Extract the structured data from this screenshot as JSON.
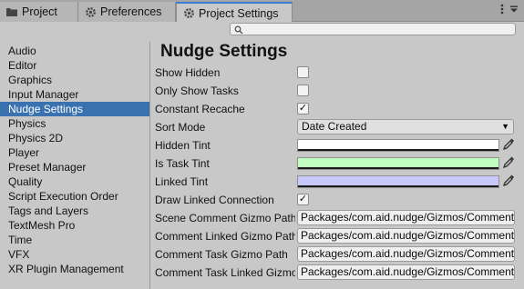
{
  "tabs": [
    {
      "label": "Project",
      "icon": "folder-icon"
    },
    {
      "label": "Preferences",
      "icon": "gear-icon"
    },
    {
      "label": "Project Settings",
      "icon": "gear-icon"
    }
  ],
  "search": {
    "placeholder": ""
  },
  "sidebar": {
    "items": [
      "Audio",
      "Editor",
      "Graphics",
      "Input Manager",
      "Nudge Settings",
      "Physics",
      "Physics 2D",
      "Player",
      "Preset Manager",
      "Quality",
      "Script Execution Order",
      "Tags and Layers",
      "TextMesh Pro",
      "Time",
      "VFX",
      "XR Plugin Management"
    ],
    "selected": "Nudge Settings"
  },
  "main": {
    "title": "Nudge Settings",
    "show_hidden": {
      "label": "Show Hidden",
      "checked": false
    },
    "only_show_tasks": {
      "label": "Only Show Tasks",
      "checked": false
    },
    "constant_recache": {
      "label": "Constant Recache",
      "checked": true,
      "mark": "✓"
    },
    "sort_mode": {
      "label": "Sort Mode",
      "value": "Date Created"
    },
    "hidden_tint": {
      "label": "Hidden Tint",
      "color": "#ffffff"
    },
    "is_task_tint": {
      "label": "Is Task Tint",
      "color": "#c1ffc1"
    },
    "linked_tint": {
      "label": "Linked Tint",
      "color": "#c8c8fa"
    },
    "draw_linked_connection": {
      "label": "Draw Linked Connection",
      "checked": true,
      "mark": "✓"
    },
    "scene_comment_gizmo_path": {
      "label": "Scene Comment Gizmo Path",
      "value": "Packages/com.aid.nudge/Gizmos/Comment"
    },
    "comment_linked_gizmo_path": {
      "label": "Comment Linked Gizmo Path",
      "value": "Packages/com.aid.nudge/Gizmos/Comment"
    },
    "comment_task_gizmo_path": {
      "label": "Comment Task Gizmo Path",
      "value": "Packages/com.aid.nudge/Gizmos/Comment"
    },
    "comment_task_linked_gizmo_path": {
      "label": "Comment Task Linked Gizmo Path",
      "value": "Packages/com.aid.nudge/Gizmos/Comment"
    }
  }
}
